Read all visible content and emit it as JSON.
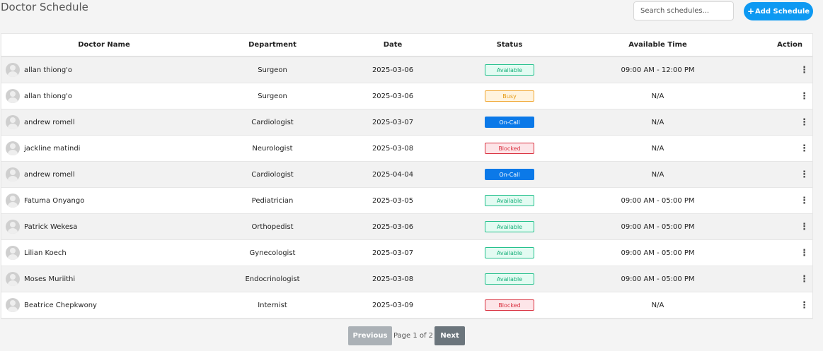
{
  "page_title": "Doctor Schedule",
  "search": {
    "placeholder": "Search schedules..."
  },
  "add_button": {
    "icon": "+",
    "label": "Add Schedule"
  },
  "columns": [
    "Doctor Name",
    "Department",
    "Date",
    "Status",
    "Available Time",
    "Action"
  ],
  "rows": [
    {
      "name": "allan thiong'o",
      "department": "Surgeon",
      "date": "2025-03-06",
      "status": "Available",
      "time": "09:00 AM - 12:00 PM"
    },
    {
      "name": "allan thiong'o",
      "department": "Surgeon",
      "date": "2025-03-06",
      "status": "Busy",
      "time": "N/A"
    },
    {
      "name": "andrew romell",
      "department": "Cardiologist",
      "date": "2025-03-07",
      "status": "On-Call",
      "time": "N/A"
    },
    {
      "name": "jackline matindi",
      "department": "Neurologist",
      "date": "2025-03-08",
      "status": "Blocked",
      "time": "N/A"
    },
    {
      "name": "andrew romell",
      "department": "Cardiologist",
      "date": "2025-04-04",
      "status": "On-Call",
      "time": "N/A"
    },
    {
      "name": "Fatuma Onyango",
      "department": "Pediatrician",
      "date": "2025-03-05",
      "status": "Available",
      "time": "09:00 AM - 05:00 PM"
    },
    {
      "name": "Patrick Wekesa",
      "department": "Orthopedist",
      "date": "2025-03-06",
      "status": "Available",
      "time": "09:00 AM - 05:00 PM"
    },
    {
      "name": "Lilian Koech",
      "department": "Gynecologist",
      "date": "2025-03-07",
      "status": "Available",
      "time": "09:00 AM - 05:00 PM"
    },
    {
      "name": "Moses Muriithi",
      "department": "Endocrinologist",
      "date": "2025-03-08",
      "status": "Available",
      "time": "09:00 AM - 05:00 PM"
    },
    {
      "name": "Beatrice Chepkwony",
      "department": "Internist",
      "date": "2025-03-09",
      "status": "Blocked",
      "time": "N/A"
    }
  ],
  "action_icon": "⋮",
  "pagination": {
    "previous": "Previous",
    "info": "Page 1 of 2",
    "next": "Next"
  },
  "status_colors": {
    "Available": "#23c08c",
    "Busy": "#f0a630",
    "On-Call": "#0b79e8",
    "Blocked": "#d9303f"
  }
}
